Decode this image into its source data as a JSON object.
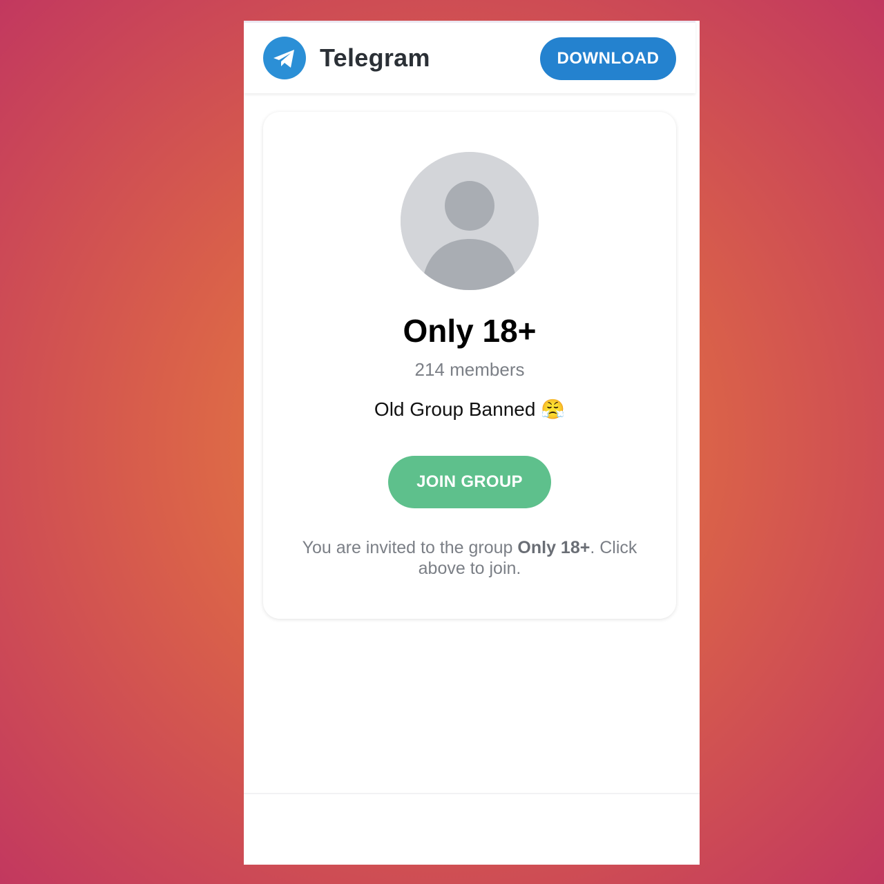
{
  "header": {
    "app_name": "Telegram",
    "logo_icon": "telegram-paper-plane-icon",
    "download_label": "DOWNLOAD"
  },
  "group": {
    "title": "Only 18+",
    "members": "214 members",
    "description": "Old Group Banned",
    "description_emoji": "😤",
    "join_label": "JOIN GROUP",
    "invite_prefix": "You are invited to the group ",
    "invite_name": "Only 18+",
    "invite_suffix": ". Click above to join."
  },
  "colors": {
    "accent_blue": "#2482cf",
    "join_green": "#5ec08c",
    "muted_text": "#7b7f86"
  }
}
